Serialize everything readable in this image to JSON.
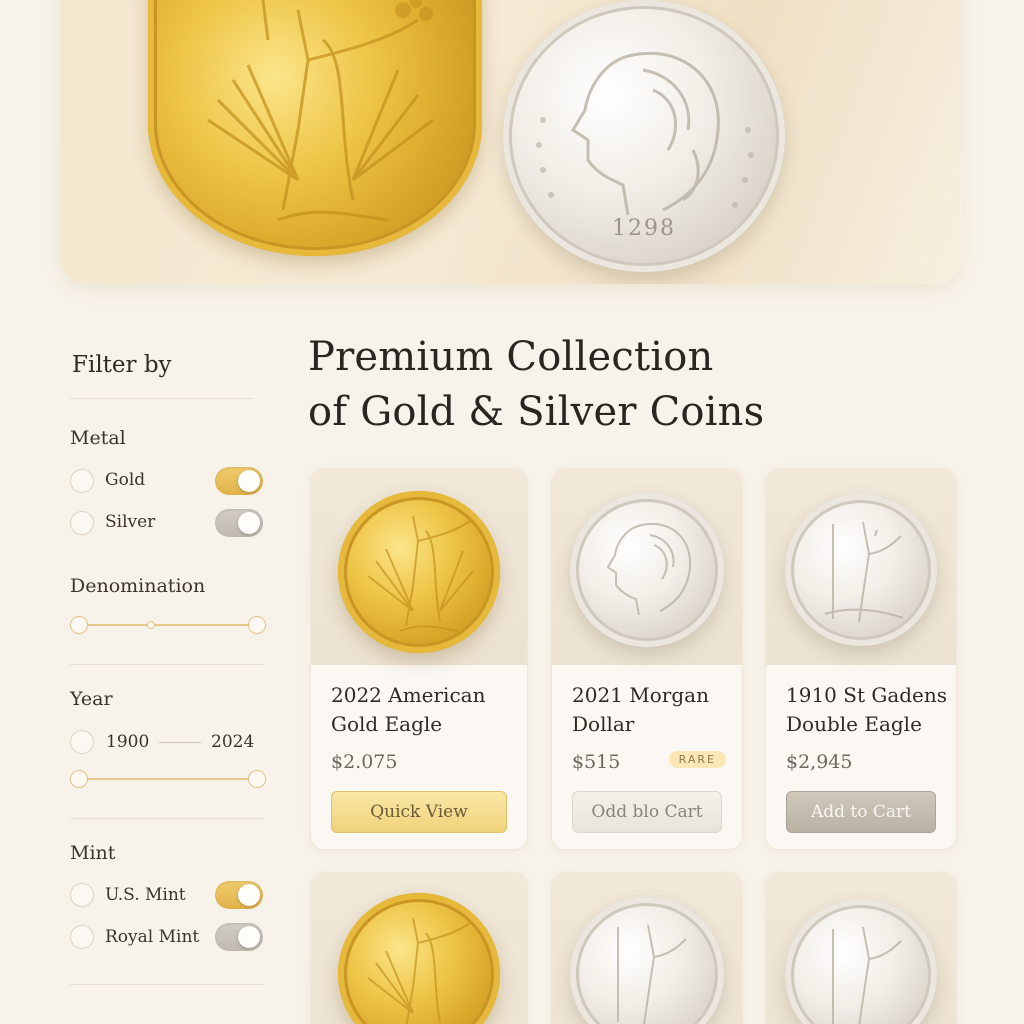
{
  "hero": {
    "gold_coin": "gold-liberty-coin-icon",
    "silver_coin": "silver-morgan-coin-icon",
    "silver_date": "1298"
  },
  "sidebar": {
    "title": "Filter by",
    "metal": {
      "label": "Metal",
      "options": [
        {
          "label": "Gold",
          "toggle": "on"
        },
        {
          "label": "Silver",
          "toggle": "off"
        }
      ]
    },
    "denomination": {
      "label": "Denomination"
    },
    "year": {
      "label": "Year",
      "from": "1900",
      "to": "2024"
    },
    "mint": {
      "label": "Mint",
      "options": [
        {
          "label": "U.S. Mint",
          "toggle": "on"
        },
        {
          "label": "Royal Mint",
          "toggle": "off"
        }
      ]
    }
  },
  "main": {
    "heading_line1": "Premium Collection",
    "heading_line2": "of Gold & Silver Coins",
    "products": [
      {
        "name_line1": "2022 American",
        "name_line2": "Gold Eagle",
        "price": "$2.075",
        "button": "Quick View",
        "metal": "gold"
      },
      {
        "name_line1": "2021 Morgan",
        "name_line2": "Dollar",
        "price": "$515",
        "badge": "RARE",
        "button": "Odd blo Cart",
        "metal": "silver"
      },
      {
        "name_line1": "1910 St Gadens",
        "name_line2": "Double Eagle",
        "price": "$2,945",
        "button": "Add to Cart",
        "metal": "silver"
      },
      {
        "metal": "gold"
      },
      {
        "metal": "silver"
      },
      {
        "metal": "silver"
      }
    ]
  },
  "colors": {
    "background": "#f8f3ea",
    "accent_gold": "#e0b24b",
    "text": "#2f2a24"
  }
}
